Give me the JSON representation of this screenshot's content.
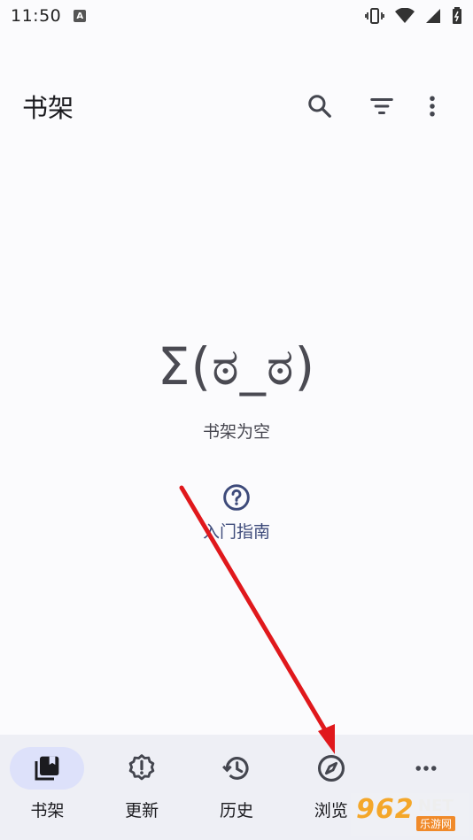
{
  "status_bar": {
    "time": "11:50",
    "notif_letter": "A"
  },
  "app_bar": {
    "title": "书架"
  },
  "empty_state": {
    "face": "Σ(ಠ_ಠ)",
    "message": "书架为空"
  },
  "guide": {
    "label": "入门指南"
  },
  "nav": {
    "items": [
      {
        "label": "书架",
        "icon": "bookshelf-icon",
        "active": true
      },
      {
        "label": "更新",
        "icon": "update-alert-icon",
        "active": false
      },
      {
        "label": "历史",
        "icon": "history-icon",
        "active": false
      },
      {
        "label": "浏览",
        "icon": "compass-icon",
        "active": false
      },
      {
        "label": "",
        "icon": "more-icon",
        "active": false
      }
    ]
  },
  "watermark": {
    "num": "962",
    "net": "NET",
    "sub": "乐游网"
  },
  "colors": {
    "accent_pill": "#dde1fa",
    "arrow": "#e0181c",
    "nav_bg": "#eeeff5"
  }
}
